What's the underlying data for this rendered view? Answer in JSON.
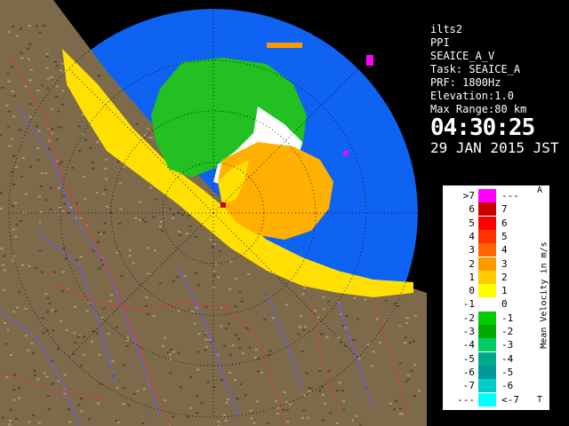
{
  "info": {
    "station": "ilts2",
    "product": "PPI",
    "product_detail": "SEAICE_A_V",
    "task": "Task: SEAICE_A",
    "prf": "PRF: 1800Hz",
    "elevation": "Elevation:1.0",
    "max_range": "Max Range:80 km",
    "time": "04:30:25",
    "date": "29 JAN 2015 JST"
  },
  "legend": {
    "title": "Mean Velocity in m/s",
    "top_mark": "A",
    "bottom_mark": "T",
    "rows": [
      {
        "left": ">7",
        "right": "---",
        "color": "#ff00ff"
      },
      {
        "left": "6",
        "right": "7",
        "color": "#cc0000"
      },
      {
        "left": "5",
        "right": "6",
        "color": "#ff0000"
      },
      {
        "left": "4",
        "right": "5",
        "color": "#ff3300"
      },
      {
        "left": "3",
        "right": "4",
        "color": "#ff6600"
      },
      {
        "left": "2",
        "right": "3",
        "color": "#ff9900"
      },
      {
        "left": "1",
        "right": "2",
        "color": "#ffcc00"
      },
      {
        "left": "0",
        "right": "1",
        "color": "#ffff00"
      },
      {
        "left": "-1",
        "right": "0",
        "color": "#ffffff"
      },
      {
        "left": "-2",
        "right": "-1",
        "color": "#00cc00"
      },
      {
        "left": "-3",
        "right": "-2",
        "color": "#00aa00"
      },
      {
        "left": "-4",
        "right": "-3",
        "color": "#00cc66"
      },
      {
        "left": "-5",
        "right": "-4",
        "color": "#00aa88"
      },
      {
        "left": "-6",
        "right": "-5",
        "color": "#009999"
      },
      {
        "left": "-7",
        "right": "-6",
        "color": "#00cccc"
      },
      {
        "left": "---",
        "right": "<-7",
        "color": "#00ffff"
      }
    ]
  },
  "colors": {
    "sea": "#0f63f2",
    "land": "#8a7350",
    "background": "#000000",
    "text": "#ffffff"
  }
}
